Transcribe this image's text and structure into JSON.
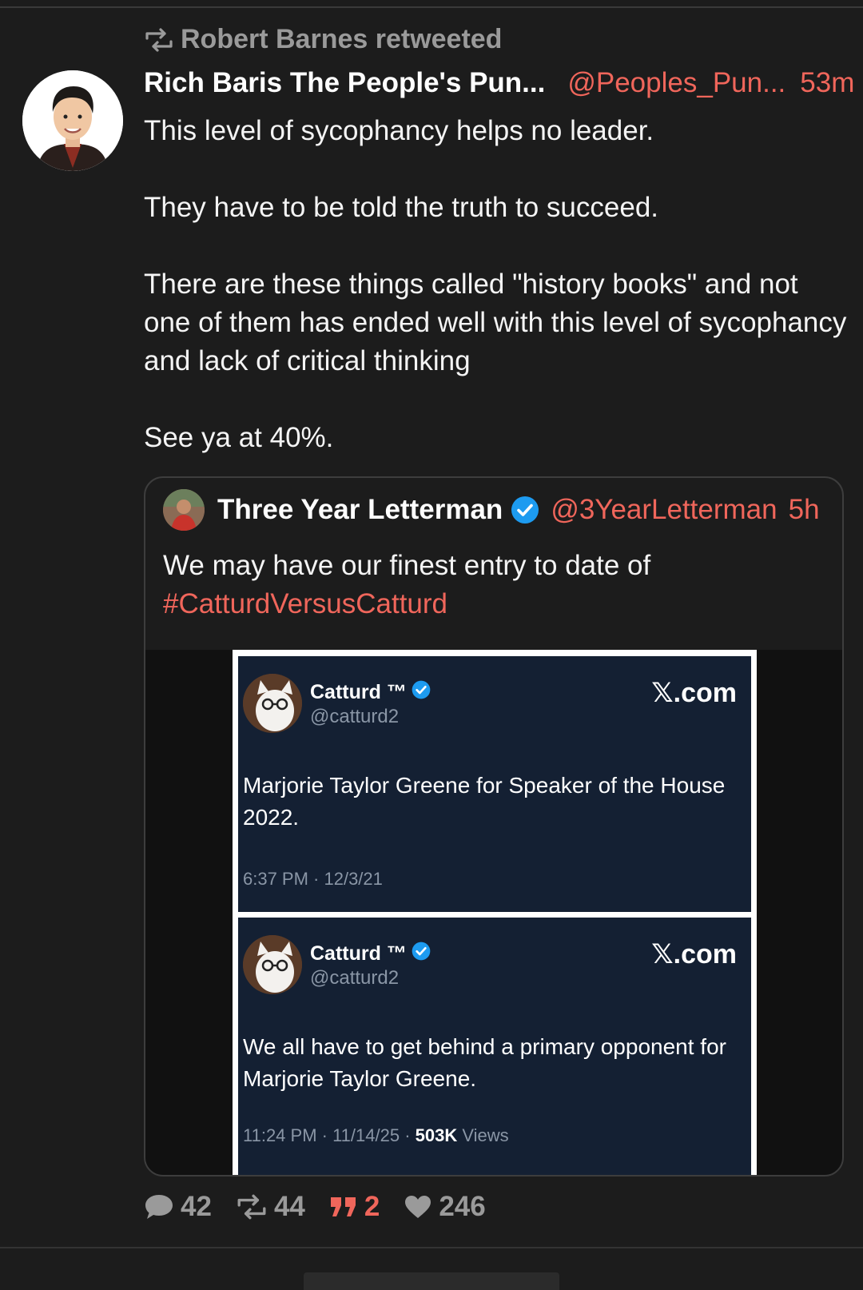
{
  "retweet_banner": {
    "text": "Robert Barnes retweeted",
    "icon": "retweet-icon"
  },
  "post": {
    "author_name": "Rich Baris The People's Pun...",
    "author_handle": "@Peoples_Pun...",
    "time": "53m",
    "paragraphs": [
      "This level of sycophancy helps no leader.",
      "They have to be told the truth to succeed.",
      "There are these things called \"history books\" and not one of them has ended well with this level of sycophancy and lack of critical thinking",
      "See ya at 40%."
    ]
  },
  "quote": {
    "author_name": "Three Year Letterman",
    "author_handle": "@3YearLetterman",
    "time": "5h",
    "text": "We may have our finest entry to date of",
    "hashtag": "#CatturdVersusCatturd",
    "embedded_tweets": [
      {
        "name": "Catturd ™",
        "handle": "@catturd2",
        "brand": "𝕏.com",
        "text": "Marjorie Taylor Greene for Speaker of the House 2022.",
        "meta": "6:37 PM · 12/3/21"
      },
      {
        "name": "Catturd ™",
        "handle": "@catturd2",
        "brand": "𝕏.com",
        "text": "We all have to get behind a primary opponent for Marjorie Taylor Greene.",
        "meta": "11:24 PM · 11/14/25 · ",
        "views_count": "503K",
        "views_label": " Views"
      }
    ]
  },
  "actions": {
    "replies": "42",
    "reposts": "44",
    "quotes": "2",
    "likes": "246"
  },
  "colors": {
    "background": "#1c1c1c",
    "accent": "#f0665b",
    "muted": "#9a9a9a",
    "verified": "#1d9bf0",
    "embedded_card_bg": "#142033"
  }
}
